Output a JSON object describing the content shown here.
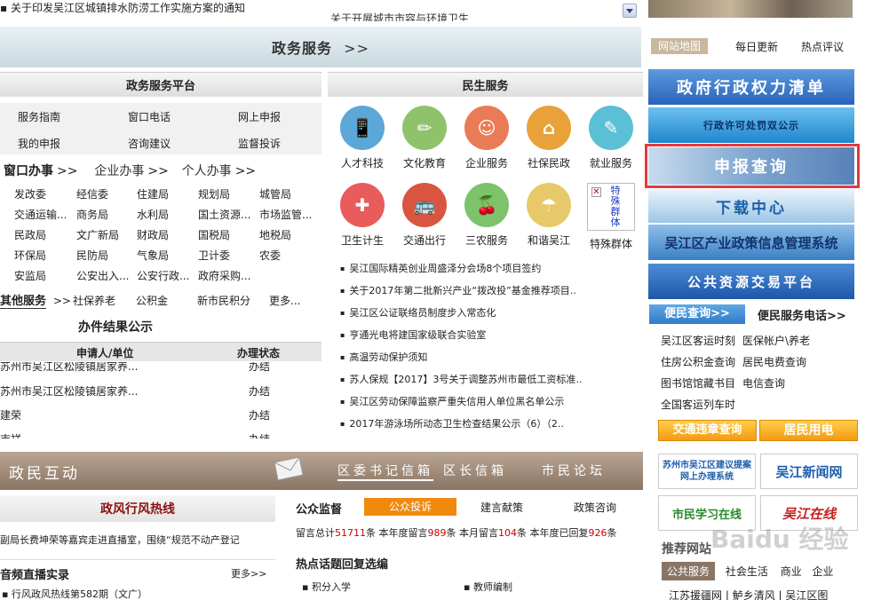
{
  "top": {
    "notice1": "关于印发吴江区城镇排水防涝工作实施方案的通知",
    "notice2": "关于开展城市市容与环境卫生"
  },
  "gov_bar": {
    "title": "政务服务",
    "arrow": ">>"
  },
  "platform": {
    "title": "政务服务平台",
    "items": [
      "服务指南",
      "窗口电话",
      "网上申报",
      "我的申报",
      "咨询建议",
      "监督投诉"
    ]
  },
  "tabs": {
    "window": "窗口办事",
    "enterprise": "企业办事",
    "personal": "个人办事",
    "arrow": ">>"
  },
  "depts": [
    "发改委",
    "经信委",
    "住建局",
    "规划局",
    "城管局",
    "交通运输...",
    "商务局",
    "水利局",
    "国土资源...",
    "市场监管...",
    "民政局",
    "文广新局",
    "财政局",
    "国税局",
    "地税局",
    "环保局",
    "民防局",
    "气象局",
    "卫计委",
    "农委",
    "安监局",
    "公安出入...",
    "公安行政...",
    "政府采购..."
  ],
  "other": {
    "title": "其他服务",
    "arrow": ">>",
    "items": [
      "社保养老",
      "公积金",
      "新市民积分",
      "更多..."
    ]
  },
  "results": {
    "title": "办件结果公示",
    "col_applicant": "申请人/单位",
    "col_status": "办理状态",
    "rows": [
      {
        "name": "苏州市吴江区松陵镇居家养...",
        "status": "办结"
      },
      {
        "name": "苏州市吴江区松陵镇居家养...",
        "status": "办结"
      },
      {
        "name": "建荣",
        "status": "办结"
      },
      {
        "name": "吉祥",
        "status": "办结"
      }
    ]
  },
  "people": {
    "title": "民生服务",
    "services": [
      {
        "label": "人才科技",
        "icon": "talent-icon",
        "color": "#5aa7d8"
      },
      {
        "label": "文化教育",
        "icon": "culture-icon",
        "color": "#8fc36b"
      },
      {
        "label": "企业服务",
        "icon": "enterprise-icon",
        "color": "#e97b56"
      },
      {
        "label": "社保民政",
        "icon": "social-icon",
        "color": "#e9a23a"
      },
      {
        "label": "就业服务",
        "icon": "employment-icon",
        "color": "#5bbfd6"
      },
      {
        "label": "卫生计生",
        "icon": "health-icon",
        "color": "#e85c5c"
      },
      {
        "label": "交通出行",
        "icon": "traffic-icon",
        "color": "#d9553f"
      },
      {
        "label": "三农服务",
        "icon": "farm-icon",
        "color": "#7cc36b"
      },
      {
        "label": "和谐吴江",
        "icon": "umbrella-icon",
        "color": "#e7c96a"
      },
      {
        "label": "特殊群体",
        "icon": "special-icon",
        "color": "#ffffff"
      }
    ],
    "special_alt": "特殊群体"
  },
  "news": [
    "吴江国际精英创业周盛泽分会场8个项目签约",
    "关于2017年第二批新兴产业“拨改投”基金推荐项目..",
    "吴江区公证联络员制度步入常态化",
    "亨通光电将建国家级联合实验室",
    "高温劳动保护须知",
    "苏人保规【2017】3号关于调整苏州市最低工资标准..",
    "吴江区劳动保障监察严重失信用人单位黑名单公示",
    "2017年游泳场所动态卫生检查结果公示（6）（2.."
  ],
  "interaction": {
    "title": "政民互动",
    "tabs": [
      "区委书记信箱",
      "区长信箱",
      "市民论坛"
    ]
  },
  "hotline": {
    "title": "政风行风热线",
    "news": "副局长费坤荣等嘉宾走进直播室，围绕“规范不动产登记",
    "audio_title": "音频直播实录",
    "more": "更多>>",
    "item1": "行风政风热线第582期（文广）"
  },
  "supervision": {
    "title": "公众监督",
    "tabs": [
      "公众投诉",
      "建言献策",
      "政策咨询"
    ],
    "stats_parts": [
      "留言总计",
      "51711",
      "条 本年度留言",
      "989",
      "条 本月留言",
      "104",
      "条 本年度已回复",
      "926",
      "条"
    ],
    "hot_title": "热点话题回复选编",
    "hot_items": [
      "积分入学",
      "教师编制"
    ]
  },
  "right": {
    "links_top": [
      "网站地图",
      "每日更新",
      "热点评议"
    ],
    "banners": [
      {
        "label": "政府行政权力清单",
        "color": "#2f6fc2"
      },
      {
        "label": "行政许可处罚双公示",
        "color": "#2a8fcc"
      },
      {
        "label": "申报查询",
        "color": "#6e9ac6"
      },
      {
        "label": "下载中心",
        "color": "#b9d6ec"
      },
      {
        "label": "吴江区产业政策信息管理系统",
        "color": "#3c7fc4"
      },
      {
        "label": "公共资源交易平台",
        "color": "#2c68b6"
      }
    ],
    "convenience_query": "便民查询>>",
    "convenience_phone": "便民服务电话>>",
    "query_links": [
      "吴江区客运时刻",
      "医保帐户\\养老",
      "住房公积金查询",
      "居民电费查询",
      "图书馆馆藏书目",
      "电信查询",
      "全国客运列车时"
    ],
    "btn_traffic": "交通违章查询",
    "btn_power": "居民用电",
    "logos": [
      "苏州市吴江区建议提案网上办理系统",
      "吴江新闻网",
      "市民学习在线",
      "吴江在线"
    ],
    "recommend": "推荐网站",
    "recommend_tabs": [
      "公共服务",
      "社会生活",
      "商业",
      "企业"
    ],
    "bottom_links": [
      "江苏援疆网",
      "鲈乡清风",
      "吴江区图"
    ],
    "watermark": "Baidu 经验"
  }
}
